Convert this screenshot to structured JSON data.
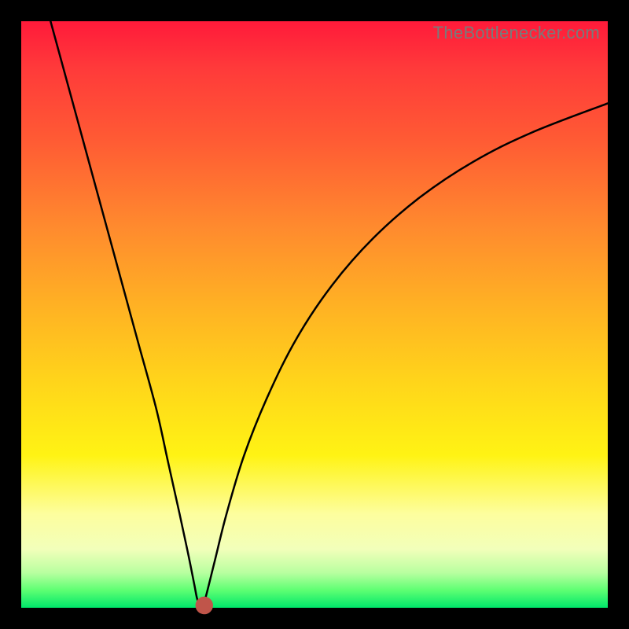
{
  "attribution": "TheBottlenecker.com",
  "chart_data": {
    "type": "line",
    "title": "",
    "xlabel": "",
    "ylabel": "",
    "xlim": [
      0,
      100
    ],
    "ylim": [
      0,
      100
    ],
    "series": [
      {
        "name": "bottleneck-curve",
        "x": [
          5,
          8,
          11,
          14,
          17,
          20,
          23,
          25,
          27,
          28.5,
          29.5,
          30,
          30.5,
          31,
          31.5,
          33,
          35,
          38,
          42,
          47,
          53,
          60,
          68,
          77,
          87,
          100
        ],
        "y": [
          100,
          89,
          78,
          67,
          56,
          45,
          34,
          25,
          16,
          9,
          4,
          1.5,
          0.5,
          0.5,
          2,
          8,
          16,
          26,
          36,
          46,
          55,
          63,
          70,
          76,
          81,
          86
        ]
      }
    ],
    "marker": {
      "x": 31.2,
      "y": 0.4,
      "r": 1.0
    },
    "gradient_stops": [
      {
        "pct": 0,
        "color": "#ff1a3a"
      },
      {
        "pct": 35,
        "color": "#ff8a2e"
      },
      {
        "pct": 62,
        "color": "#ffd61a"
      },
      {
        "pct": 84,
        "color": "#fdfe9e"
      },
      {
        "pct": 97,
        "color": "#5eff73"
      },
      {
        "pct": 100,
        "color": "#00e66a"
      }
    ]
  }
}
